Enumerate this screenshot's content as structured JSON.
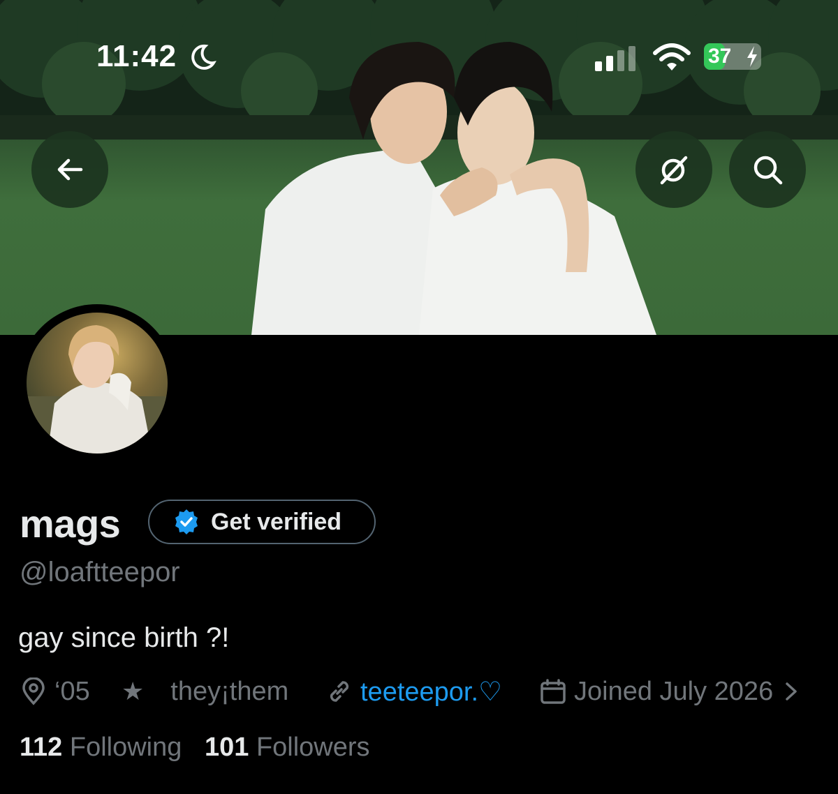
{
  "status_bar": {
    "time": "11:42",
    "battery": "37",
    "battery_level": 0.37
  },
  "header": {
    "back_icon": "arrow-left-icon",
    "grok_icon": "grok-icon",
    "search_icon": "search-icon"
  },
  "profile": {
    "display_name": "mags",
    "get_verified_label": "Get verified",
    "handle": "@loaftteepor",
    "bio": "gay since birth ?!",
    "location": "‘05",
    "pronouns": "they¡them",
    "website": "teeteepor.♡",
    "joined": "Joined July 2026",
    "following_count": "112",
    "following_label": "Following",
    "followers_count": "101",
    "followers_label": "Followers"
  },
  "colors": {
    "background": "#000000",
    "text_primary": "#e7e9ea",
    "text_secondary": "#71767b",
    "link": "#1d9bf0",
    "verified_badge": "#1d9bf0",
    "battery_charging": "#34c759"
  }
}
